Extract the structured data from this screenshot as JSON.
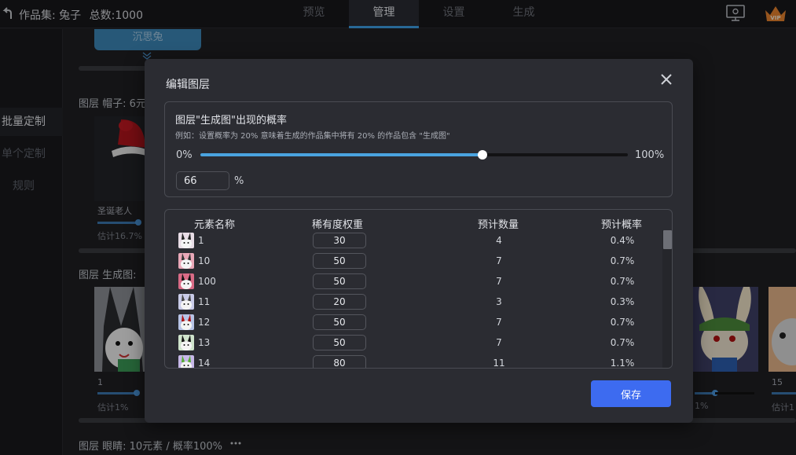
{
  "topbar": {
    "collection_label": "作品集: 兔子",
    "total_label": "总数:1000",
    "tabs": [
      {
        "label": "预览",
        "active": false
      },
      {
        "label": "管理",
        "active": true
      },
      {
        "label": "设置",
        "active": false
      },
      {
        "label": "生成",
        "active": false
      }
    ],
    "icons": [
      "back-icon",
      "monitor-icon",
      "vip-crown-icon"
    ],
    "vip_label": "VIP"
  },
  "sidebar": {
    "items": [
      {
        "label": "批量定制",
        "active": true
      },
      {
        "label": "单个定制",
        "active": false
      },
      {
        "label": "规则",
        "active": false
      }
    ]
  },
  "background": {
    "top_chip_label": "沉思兔",
    "layer_hat_label": "图层  帽子: 6元",
    "hat_card": {
      "name": "圣诞老人",
      "estimate": "估计16.7%"
    },
    "layer_gen_label": "图层  生成图:",
    "gen_cards": [
      {
        "name": "1",
        "estimate": "估计1%"
      },
      {
        "name": "",
        "estimate": "1%"
      },
      {
        "name": "15",
        "estimate": "估计1"
      }
    ],
    "layer_eyes_label": "图层  眼睛: 10元素 / 概率100%",
    "more_icon": "more-dots-icon"
  },
  "modal": {
    "title": "编辑图层",
    "probability": {
      "title": "图层\"生成图\"出现的概率",
      "description": "例如：设置概率为 20% 意味着生成的作品集中将有 20% 的作品包含 \"生成图\"",
      "min_label": "0%",
      "max_label": "100%",
      "value": 66,
      "input_value": "66",
      "unit": "%"
    },
    "table": {
      "headers": [
        "元素名称",
        "稀有度权重",
        "预计数量",
        "预计概率"
      ],
      "rows": [
        {
          "name": "1",
          "weight": "30",
          "count": "4",
          "prob": "0.4%"
        },
        {
          "name": "10",
          "weight": "50",
          "count": "7",
          "prob": "0.7%"
        },
        {
          "name": "100",
          "weight": "50",
          "count": "7",
          "prob": "0.7%"
        },
        {
          "name": "11",
          "weight": "20",
          "count": "3",
          "prob": "0.3%"
        },
        {
          "name": "12",
          "weight": "50",
          "count": "7",
          "prob": "0.7%"
        },
        {
          "name": "13",
          "weight": "50",
          "count": "7",
          "prob": "0.7%"
        },
        {
          "name": "14",
          "weight": "80",
          "count": "11",
          "prob": "1.1%"
        }
      ]
    },
    "save_label": "保存"
  },
  "colors": {
    "accent": "#4aa3e0",
    "primary_button": "#3d6bf0",
    "modal_bg": "#2b2c32"
  }
}
